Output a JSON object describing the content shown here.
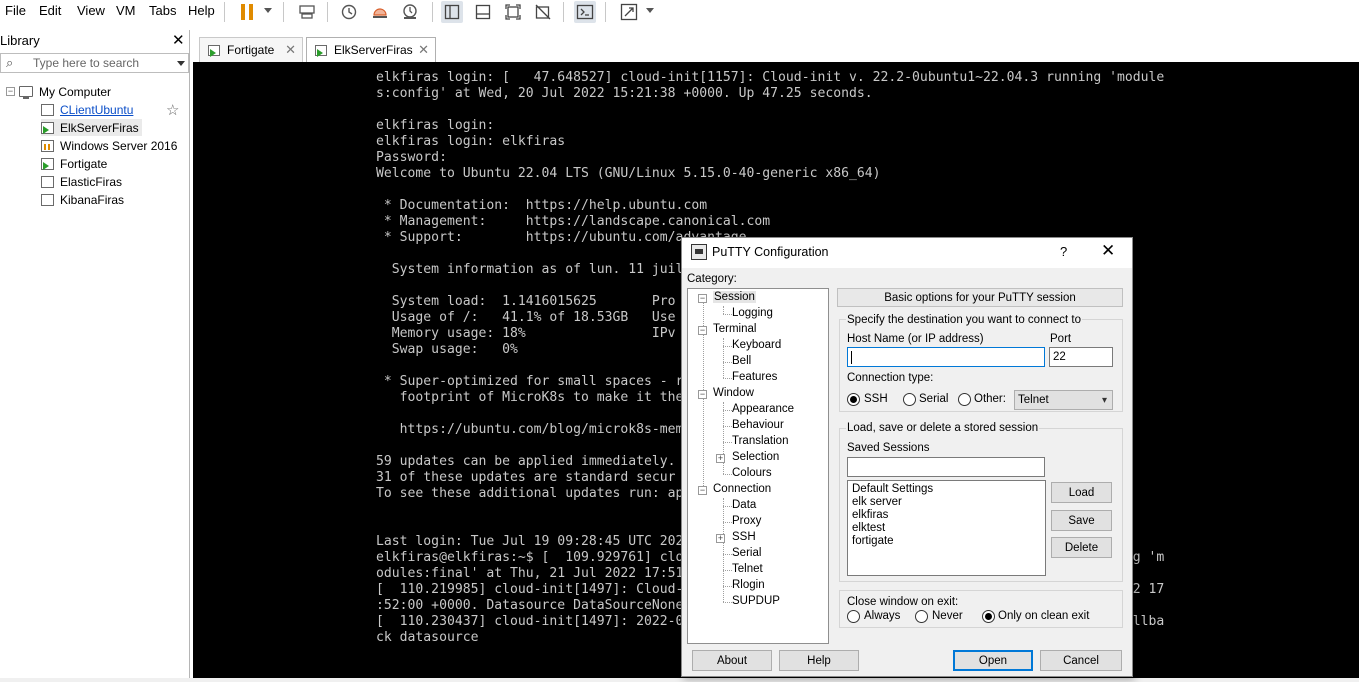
{
  "menu": {
    "file": "File",
    "edit": "Edit",
    "view": "View",
    "vm": "VM",
    "tabs": "Tabs",
    "help": "Help"
  },
  "toolbar": {
    "icons": [
      "pause-icon",
      "send-ctrl-alt-del-icon",
      "snapshot-icon",
      "revert-snapshot-icon",
      "snapshot-manager-icon",
      "library-view-icon",
      "thumbnail-view-icon",
      "full-screen-icon",
      "unity-icon",
      "console-view-icon",
      "stretch-guest-icon"
    ],
    "accent_color": "#e08b00"
  },
  "library": {
    "title": "Library",
    "search_placeholder": "Type here to search",
    "root": "My Computer",
    "items": [
      {
        "label": "CLientUbuntu",
        "state": "off"
      },
      {
        "label": "ElkServerFiras",
        "state": "running"
      },
      {
        "label": "Windows Server 2016",
        "state": "paused"
      },
      {
        "label": "Fortigate",
        "state": "running"
      },
      {
        "label": "ElasticFiras",
        "state": "off"
      },
      {
        "label": "KibanaFiras",
        "state": "off"
      }
    ]
  },
  "tabs": [
    {
      "label": "Fortigate",
      "active": false
    },
    {
      "label": "ElkServerFiras",
      "active": true
    }
  ],
  "console": {
    "lines": [
      "elkfiras login: [   47.648527] cloud-init[1157]: Cloud-init v. 22.2-0ubuntu1~22.04.3 running 'module",
      "s:config' at Wed, 20 Jul 2022 15:21:38 +0000. Up 47.25 seconds.",
      "",
      "elkfiras login:",
      "elkfiras login: elkfiras",
      "Password:",
      "Welcome to Ubuntu 22.04 LTS (GNU/Linux 5.15.0-40-generic x86_64)",
      "",
      " * Documentation:  https://help.ubuntu.com",
      " * Management:     https://landscape.canonical.com",
      " * Support:        https://ubuntu.com/advantage",
      "",
      "  System information as of lun. 11 juil",
      "",
      "  System load:  1.1416015625       Pro",
      "  Usage of /:   41.1% of 18.53GB   Use",
      "  Memory usage: 18%                IPv",
      "  Swap usage:   0%",
      "",
      " * Super-optimized for small spaces - r",
      "   footprint of MicroK8s to make it the",
      "",
      "   https://ubuntu.com/blog/microk8s-mem",
      "",
      "59 updates can be applied immediately.",
      "31 of these updates are standard secur",
      "To see these additional updates run: ap",
      "",
      "",
      "Last login: Tue Jul 19 09:28:45 UTC 202",
      "elkfiras@elkfiras:~$ [  109.929761] cloud-init[1497]: Cloud-init v. 22.2-0ubuntu1~22.04.3 running 'm",
      "odules:final' at Thu, 21 Jul 2022 17:51:59 +0000. Up 109.47 seconds.",
      "[  110.219985] cloud-init[1497]: Cloud-init v. 22.2-0ubuntu1~22.04.3 finished at Thu, 21 Jul 2022 17",
      ":52:00 +0000. Datasource DataSourceNone.  Up 110.17 seconds",
      "[  110.230437] cloud-init[1497]: 2022-07-21 17:52:00,130 - cc_final_message.py[WARNING]: Used fallba",
      "ck datasource"
    ]
  },
  "putty": {
    "title": "PuTTY Configuration",
    "help_btn": "?",
    "close_btn": "✕",
    "category_label": "Category:",
    "categories": {
      "session": "Session",
      "logging": "Logging",
      "terminal": "Terminal",
      "keyboard": "Keyboard",
      "bell": "Bell",
      "features": "Features",
      "window": "Window",
      "appearance": "Appearance",
      "behaviour": "Behaviour",
      "translation": "Translation",
      "selection": "Selection",
      "colours": "Colours",
      "connection": "Connection",
      "data": "Data",
      "proxy": "Proxy",
      "ssh": "SSH",
      "serial": "Serial",
      "telnet": "Telnet",
      "rlogin": "Rlogin",
      "supdup": "SUPDUP"
    },
    "panel_title": "Basic options for your PuTTY session",
    "dest_label": "Specify the destination you want to connect to",
    "host_label": "Host Name (or IP address)",
    "host_value": "",
    "port_label": "Port",
    "port_value": "22",
    "conn_type_label": "Connection type:",
    "conn_types": {
      "ssh": "SSH",
      "serial": "Serial",
      "other": "Other:"
    },
    "conn_selected": "SSH",
    "other_select": "Telnet",
    "load_save_label": "Load, save or delete a stored session",
    "saved_sessions_label": "Saved Sessions",
    "saved_sessions_value": "",
    "sessions": [
      "Default Settings",
      "elk server",
      "elkfiras",
      "elktest",
      "fortigate"
    ],
    "btn_load": "Load",
    "btn_save": "Save",
    "btn_delete": "Delete",
    "close_label": "Close window on exit:",
    "close_options": {
      "always": "Always",
      "never": "Never",
      "clean": "Only on clean exit"
    },
    "close_selected": "Only on clean exit",
    "btn_about": "About",
    "btn_help": "Help",
    "btn_open": "Open",
    "btn_cancel": "Cancel"
  }
}
